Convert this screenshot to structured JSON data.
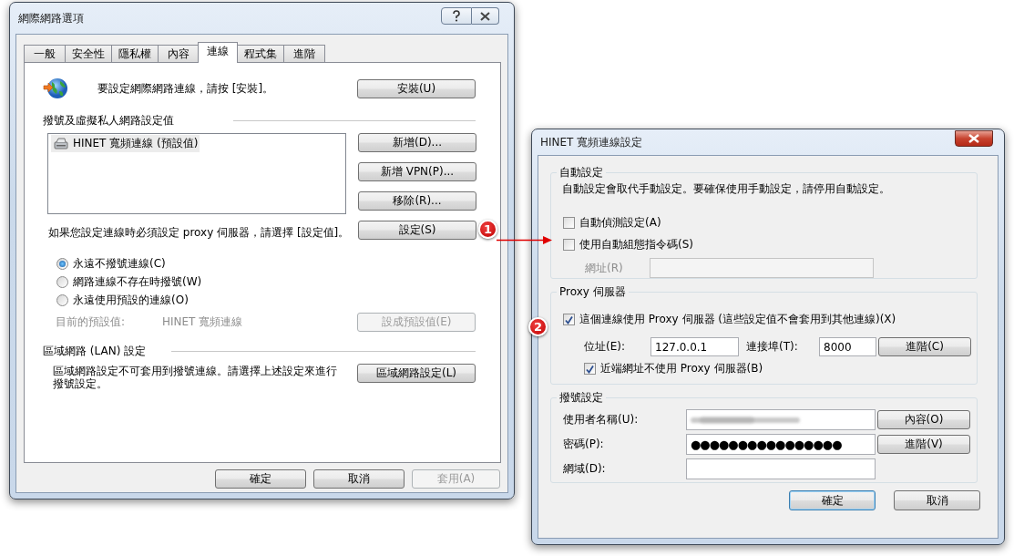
{
  "options_window": {
    "title": "網際網路選項",
    "tabs": [
      {
        "label": "一般",
        "selected": false
      },
      {
        "label": "安全性",
        "selected": false
      },
      {
        "label": "隱私權",
        "selected": false
      },
      {
        "label": "內容",
        "selected": false
      },
      {
        "label": "連線",
        "selected": true
      },
      {
        "label": "程式集",
        "selected": false
      },
      {
        "label": "進階",
        "selected": false
      }
    ],
    "setup": {
      "text": "要設定網際網路連線，請按 [安裝]。",
      "button": "安裝(U)"
    },
    "dialup_section": {
      "heading": "撥號及虛擬私人網路設定值",
      "connections": [
        {
          "name": "HINET 寬頻連線 (預設值)",
          "selected": true
        }
      ],
      "buttons": [
        "新增(D)...",
        "新增 VPN(P)...",
        "移除(R)..."
      ]
    },
    "proxy_note": {
      "text": "如果您設定連線時必須設定 proxy 伺服器，請選擇 [設定值]。",
      "button": "設定(S)",
      "callout": "1"
    },
    "dial_options": [
      {
        "label": "永遠不撥號連線(C)",
        "selected": true
      },
      {
        "label": "網路連線不存在時撥號(W)",
        "selected": false
      },
      {
        "label": "永遠使用預設的連線(O)",
        "selected": false
      }
    ],
    "default_row": {
      "label": "目前的預設值:",
      "value": "HINET 寬頻連線",
      "button": "設成預設值(E)",
      "disabled": true
    },
    "lan": {
      "heading": "區域網路 (LAN) 設定",
      "text": "區域網路設定不可套用到撥號連線。請選擇上述設定來進行撥號設定。",
      "button": "區域網路設定(L)"
    },
    "footer_buttons": [
      {
        "label": "確定",
        "disabled": false
      },
      {
        "label": "取消",
        "disabled": false
      },
      {
        "label": "套用(A)",
        "disabled": true
      }
    ]
  },
  "settings_window": {
    "title": "HINET 寬頻連線設定",
    "auto": {
      "heading": "自動設定",
      "note": "自動設定會取代手動設定。要確保使用手動設定，請停用自動設定。",
      "options": [
        {
          "label": "自動偵測設定(A)",
          "checked": false
        },
        {
          "label": "使用自動組態指令碼(S)",
          "checked": false
        }
      ],
      "address": {
        "label": "網址(R)",
        "disabled": true
      }
    },
    "proxy": {
      "heading": "Proxy 伺服器",
      "use_proxy": {
        "label": "這個連線使用 Proxy 伺服器 (這些設定值不會套用到其他連線)(X)",
        "checked": true,
        "callout": "2"
      },
      "address_label": "位址(E):",
      "address": "127.0.0.1",
      "port_label": "連接埠(T):",
      "port": "8000",
      "advanced_button": "進階(C)",
      "bypass": {
        "label": "近端網址不使用 Proxy 伺服器(B)",
        "checked": true
      }
    },
    "dialup": {
      "heading": "撥號設定",
      "fields": [
        {
          "label": "使用者名稱(U):",
          "kind": "blurred",
          "button": "內容(O)"
        },
        {
          "label": "密碼(P):",
          "kind": "password",
          "value": "●●●●●●●●●●●●●●●●",
          "button": "進階(V)"
        },
        {
          "label": "網域(D):",
          "kind": "text"
        }
      ]
    },
    "footer_buttons": [
      {
        "label": "確定",
        "default": true
      },
      {
        "label": "取消",
        "default": false
      }
    ]
  }
}
